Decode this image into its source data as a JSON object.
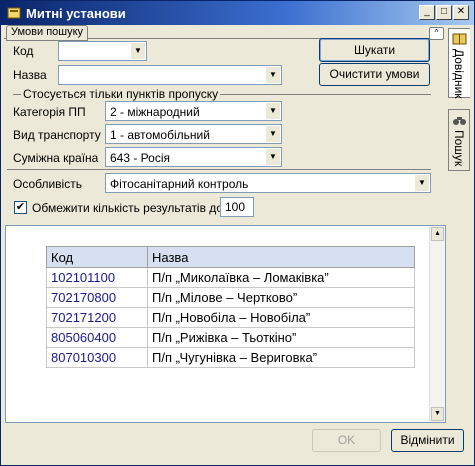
{
  "window": {
    "title": "Митні установи"
  },
  "group": {
    "title": "Умови пошуку",
    "collapse_glyph": "^"
  },
  "form": {
    "code_label": "Код",
    "code_value": "",
    "name_label": "Назва",
    "name_value": "",
    "search_button": "Шукати",
    "clear_button": "Очистити умови",
    "section_title": "Стосується тільки пунктів пропуску",
    "category_label": "Категорія ПП",
    "category_value": "2 - міжнародний",
    "transport_label": "Вид транспорту",
    "transport_value": "1 - автомобільний",
    "country_label": "Суміжна країна",
    "country_value": "643 - Росія",
    "feature_label": "Особливість",
    "feature_value": "Фітосанітарний контроль",
    "limit_label": "Обмежити кількість результатів до:",
    "limit_checked": true,
    "limit_value": "100"
  },
  "side_tabs": [
    {
      "label": "Довідник",
      "icon": "book-icon"
    },
    {
      "label": "Пошук",
      "icon": "binoculars-icon"
    }
  ],
  "results": {
    "columns": [
      "Код",
      "Назва"
    ],
    "rows": [
      {
        "code": "102101100",
        "name": "П/п „Миколаївка – Ломаківка”"
      },
      {
        "code": "702170800",
        "name": "П/п „Мілове – Чертково”"
      },
      {
        "code": "702171200",
        "name": "П/п „Новобіла – Новобіла”"
      },
      {
        "code": "805060400",
        "name": "П/п „Рижівка – Тьоткіно”"
      },
      {
        "code": "807010300",
        "name": "П/п „Чугунівка – Вериговка”"
      }
    ]
  },
  "footer": {
    "ok_button": "OK",
    "cancel_button": "Відмінити"
  }
}
